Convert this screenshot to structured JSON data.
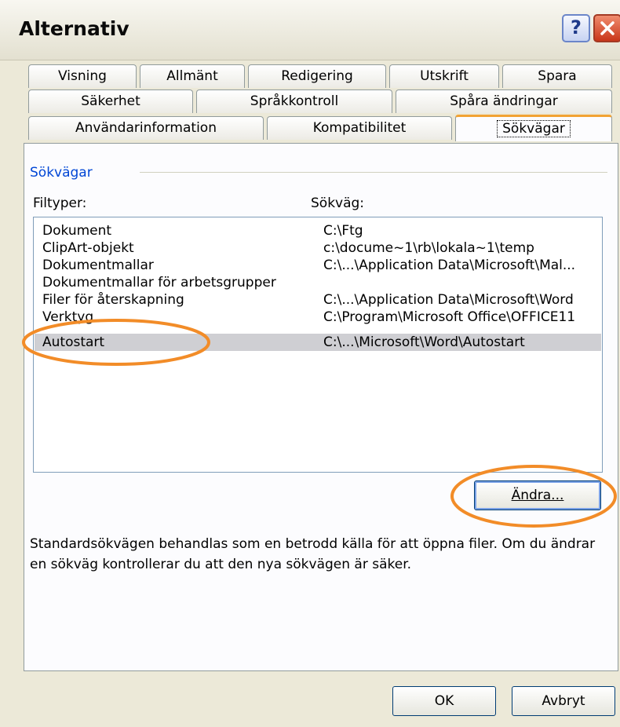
{
  "window": {
    "title": "Alternativ"
  },
  "tabs": {
    "row1": [
      {
        "label": "Visning"
      },
      {
        "label": "Allmänt"
      },
      {
        "label": "Redigering"
      },
      {
        "label": "Utskrift"
      },
      {
        "label": "Spara"
      }
    ],
    "row2": [
      {
        "label": "Säkerhet"
      },
      {
        "label": "Språkkontroll"
      },
      {
        "label": "Spåra ändringar"
      }
    ],
    "row3": [
      {
        "label": "Användarinformation"
      },
      {
        "label": "Kompatibilitet"
      },
      {
        "label": "Sökvägar"
      }
    ],
    "active": "Sökvägar"
  },
  "group": {
    "label": "Sökvägar"
  },
  "headers": {
    "file_types": "Filtyper:",
    "path": "Sökväg:"
  },
  "rows": [
    {
      "type": "Dokument",
      "path": "C:\\Ftg"
    },
    {
      "type": "ClipArt-objekt",
      "path": "c:\\docume~1\\rb\\lokala~1\\temp"
    },
    {
      "type": "Dokumentmallar",
      "path": "C:\\...\\Application Data\\Microsoft\\Mal..."
    },
    {
      "type": "Dokumentmallar för arbetsgrupper",
      "path": ""
    },
    {
      "type": "Filer för återskapning",
      "path": "C:\\...\\Application Data\\Microsoft\\Word"
    },
    {
      "type": "Verktyg",
      "path": "C:\\Program\\Microsoft Office\\OFFICE11"
    },
    {
      "type": "Autostart",
      "path": "C:\\...\\Microsoft\\Word\\Autostart",
      "selected": true
    }
  ],
  "buttons": {
    "change": "Ändra...",
    "ok": "OK",
    "cancel": "Avbryt",
    "help": "?"
  },
  "description": "Standardsökvägen behandlas som en betrodd källa för att öppna filer. Om du ändrar en sökväg kontrollerar du att den nya sökvägen är säker.",
  "colors": {
    "highlight": "#f28c28",
    "active_tab_accent": "#f2a233",
    "group_label": "#0046d5"
  }
}
